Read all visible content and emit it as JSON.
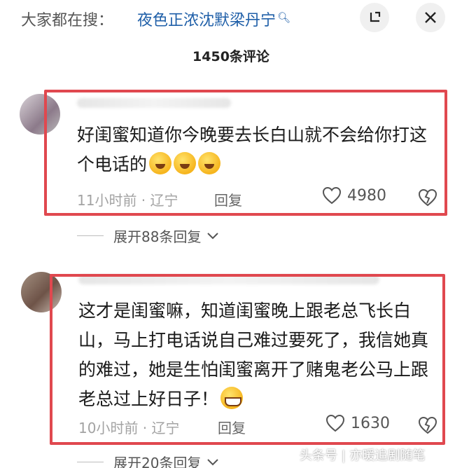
{
  "header": {
    "search_prefix": "大家都在搜：",
    "search_query": "夜色正浓沈默梁丹宁",
    "collapse_icon": "collapse-icon",
    "close_icon": "close-icon"
  },
  "comment_count": "1450条评论",
  "comments": [
    {
      "text": "好闺蜜知道你今晚要去长白山就不会给你打这个电话的",
      "emojis": [
        "crying-emoji",
        "crying-emoji",
        "crying-emoji"
      ],
      "time_location": "11小时前 · 辽宁",
      "reply_label": "回复",
      "likes": "4980",
      "expand_label": "展开88条回复"
    },
    {
      "text": "这才是闺蜜嘛，知道闺蜜晚上跟老总飞长白山，马上打电话说自己难过要死了，我信她真的难过，她是生怕闺蜜离开了赌鬼老公马上跟老总过上好日子！",
      "emojis": [
        "grin-emoji"
      ],
      "time_location": "10小时前 · 辽宁",
      "reply_label": "回复",
      "likes": "1630",
      "expand_label": "展开20条回复"
    }
  ],
  "watermark": "头条号 | 亦暖追剧随笔",
  "colors": {
    "highlight_border": "#e0484f",
    "search_link": "#1f5fa8",
    "meta_text": "#a3a3a3"
  }
}
